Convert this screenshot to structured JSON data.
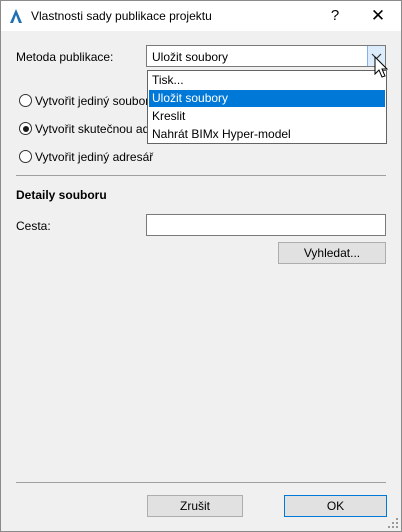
{
  "window": {
    "title": "Vlastnosti sady publikace projektu",
    "help_glyph": "?",
    "close_glyph": "✕"
  },
  "method": {
    "label": "Metoda publikace:",
    "selected": "Uložit soubory",
    "options": [
      "Tisk...",
      "Uložit soubory",
      "Kreslit",
      "Nahrát BIMx Hyper-model"
    ],
    "highlighted_index": 1
  },
  "radios": [
    {
      "label": "Vytvořit jediný soubor",
      "checked": false
    },
    {
      "label": "Vytvořit skutečnou ad",
      "checked": true
    },
    {
      "label": "Vytvořit jediný adresář",
      "checked": false
    }
  ],
  "file_details": {
    "heading": "Detaily souboru",
    "path_label": "Cesta:",
    "path_value": "",
    "browse_label": "Vyhledat..."
  },
  "buttons": {
    "cancel": "Zrušit",
    "ok": "OK"
  },
  "colors": {
    "selection": "#0078d7",
    "dialog_bg": "#f0f0f0"
  }
}
